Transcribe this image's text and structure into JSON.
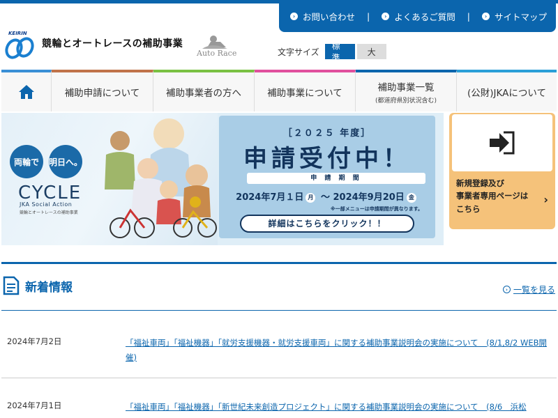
{
  "header": {
    "logo_badge": "KEIRIN",
    "site_title": "競輪とオートレースの補助事業",
    "autorace_logo": "Auto Race"
  },
  "utility_nav": {
    "items": [
      {
        "label": "お問い合わせ",
        "icon": "chevron-right-circle-icon"
      },
      {
        "label": "よくあるご質問",
        "icon": "chevron-right-circle-icon"
      },
      {
        "label": "サイトマップ",
        "icon": "chevron-right-circle-icon"
      }
    ],
    "separator": "|"
  },
  "font_size": {
    "label": "文字サイズ",
    "standard": "標準",
    "large": "大"
  },
  "main_nav": {
    "home_icon": "home-icon",
    "items": [
      {
        "label": "補助申請について",
        "sub": "",
        "accent": "#5bb0d9"
      },
      {
        "label": "補助事業者の方へ",
        "sub": "",
        "accent": "#7ac143"
      },
      {
        "label": "補助事業について",
        "sub": "",
        "accent": "#e0509e"
      },
      {
        "label": "補助事業一覧",
        "sub": "(都道府県別状況含む)",
        "accent": "#0b65ad"
      },
      {
        "label": "(公財)JKAについて",
        "sub": "",
        "accent": "#2a9fd8"
      }
    ],
    "home_accent": "#3a8fd6",
    "nav_accent_first": "#c0734a"
  },
  "banner": {
    "circle_left": "両輪で",
    "circle_right": "明日へ。",
    "cycle_title": "CYCLE",
    "cycle_sub": "JKA Social Action",
    "cycle_sub2": "競輪とオートレースの補助事業",
    "year": "［２０２５ 年度］",
    "headline": "申請受付中！",
    "period_label": "申 請 期 間",
    "date_start": "2024年7月１日",
    "day_start": "月",
    "date_sep": "～",
    "date_end": "2024年9月20日",
    "day_end": "金",
    "note": "※一部メニューは申請期間が異なります。",
    "cta": "詳細はこちらをクリック！！"
  },
  "new_registration": {
    "icon": "login-arrow-icon",
    "line1": "新規登録及び",
    "line2": "事業者専用ページは",
    "line3": "こちら",
    "arrow": "›"
  },
  "news": {
    "title": "新着情報",
    "icon": "document-icon",
    "more_label": "一覧を見る",
    "items": [
      {
        "date": "2024年7月2日",
        "text": "「福祉車両」「福祉機器」「就労支援機器・就労支援車両」に関する補助事業説明会の実施について　(8/1,8/2 WEB開催)"
      },
      {
        "date": "2024年7月1日",
        "text": "「福祉車両」「福祉機器」「新世紀未来創造プロジェクト」に関する補助事業説明会の実施について　(8/6　浜松"
      }
    ]
  },
  "colors": {
    "brand": "#0b65ad",
    "panel": "#a9cde6",
    "cta_orange": "#f5c27a"
  }
}
